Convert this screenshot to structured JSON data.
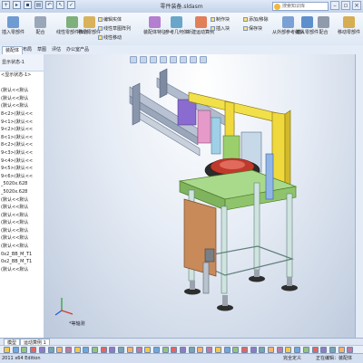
{
  "window": {
    "title": "零件装备.sldasm"
  },
  "help_search": {
    "placeholder": "搜索知识库"
  },
  "ribbon": {
    "big_buttons": [
      "插入零部件",
      "配合",
      "线性零部件阵列",
      "移动零部件",
      "显示隐藏的零部件",
      "装配体特征",
      "参考几何体",
      "新建运动算例",
      "材料明细表",
      "爆炸视图",
      "爆炸直线草图",
      "干涉检查",
      "间隙验证",
      "从外部参考编辑",
      "插入零部件",
      "配合",
      "移动零部件"
    ],
    "small_buttons": [
      "编辑实体",
      "线性草图阵列",
      "线性移动",
      "制作块",
      "添加/移除",
      "保存块",
      "插入块",
      "保存块"
    ]
  },
  "tabs": [
    "装配体",
    "布局",
    "草图",
    "评估",
    "办公室产品"
  ],
  "left_tree": {
    "header": "显示状态-1",
    "items": [
      "<显示状态-1>",
      "",
      "(默认<<默认",
      "(默认<<默认",
      "(默认<<默认",
      "8<2>(默认<<",
      "9<1>(默认<<",
      "9<2>(默认<<",
      "8<1>(默认<<",
      "8<2>(默认<<",
      "9<3>(默认<<",
      "9<4>(默认<<",
      "9<5>(默认<<",
      "9<6>(默认<<",
      "_5020x.628",
      "_5020x.628",
      "(默认<<默认",
      "(默认<<默认",
      "(默认<<默认",
      "(默认<<默认",
      "(默认<<默认",
      "(默认<<默认",
      "(默认<<默认",
      "0x2_BB_M_T1",
      "0x2_BB_M_T1",
      "(默认<<默认"
    ]
  },
  "viewport": {
    "view_label": "*等轴测"
  },
  "bottom_tabs": [
    "模型",
    "运动算例 1"
  ],
  "status": {
    "edition": "2011 x64 Edition",
    "s1": "完全定义",
    "s2": "正在编辑：装配体"
  }
}
